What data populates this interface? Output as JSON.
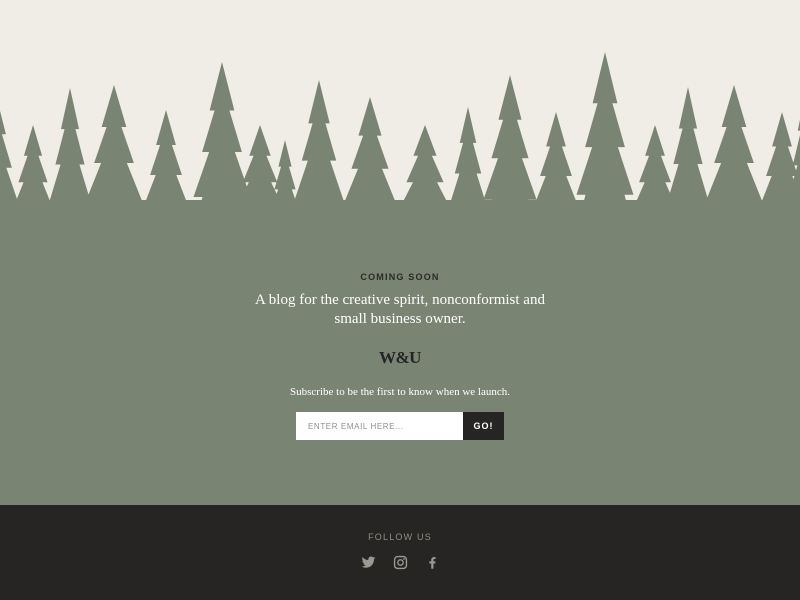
{
  "colors": {
    "background": "#efede6",
    "forest": "#7a8472",
    "footer": "#262523",
    "button": "#262523",
    "icon": "#9a9a92"
  },
  "hero": {
    "eyebrow": "COMING SOON",
    "tagline": "A blog for the creative spirit, nonconformist and small business owner.",
    "logo": "W&U",
    "subscribe_text": "Subscribe to be the first to know when we launch.",
    "email_placeholder": "ENTER EMAIL HERE...",
    "email_value": "",
    "submit_label": "GO!"
  },
  "footer": {
    "follow_label": "FOLLOW US",
    "social": [
      {
        "icon": "twitter-icon"
      },
      {
        "icon": "instagram-icon"
      },
      {
        "icon": "facebook-icon"
      }
    ]
  }
}
